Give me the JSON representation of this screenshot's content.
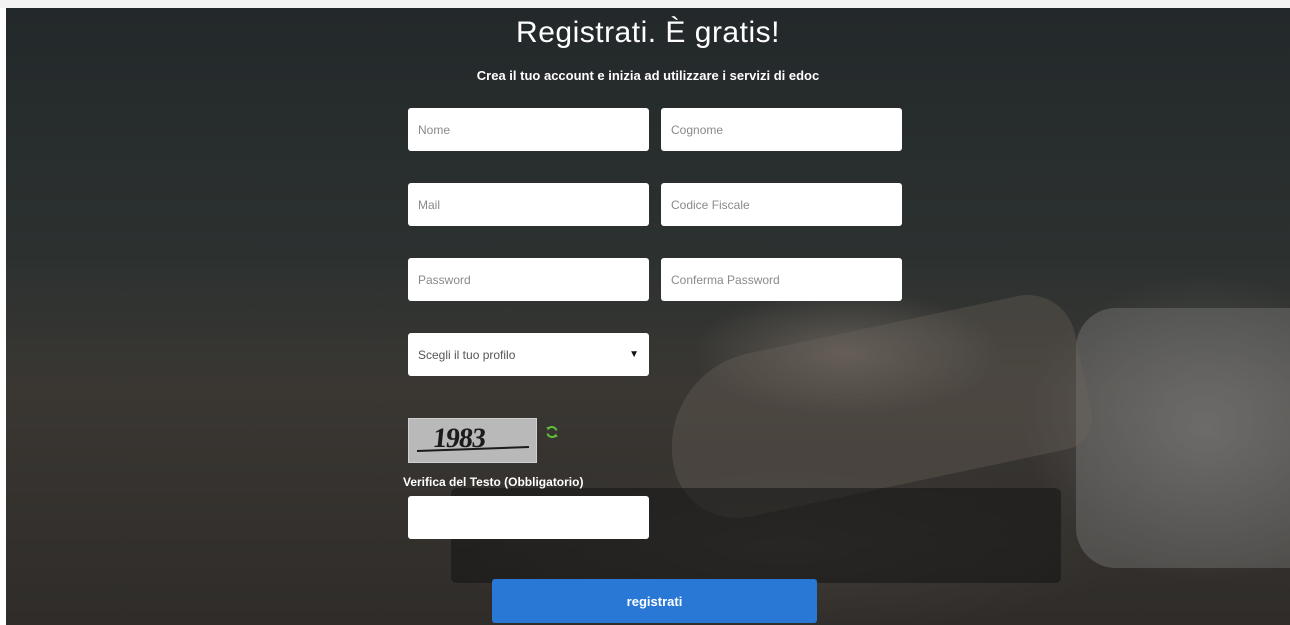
{
  "header": {
    "title": "Registrati. È gratis!",
    "subtitle": "Crea il tuo account e inizia ad utilizzare i servizi di edoc"
  },
  "form": {
    "nome_placeholder": "Nome",
    "cognome_placeholder": "Cognome",
    "mail_placeholder": "Mail",
    "codice_fiscale_placeholder": "Codice Fiscale",
    "password_placeholder": "Password",
    "conferma_password_placeholder": "Conferma Password",
    "profile_select": "Scegli il tuo profilo",
    "captcha_text": "1983",
    "captcha_label": "Verifica del Testo (Obbligatorio)",
    "submit_label": "registrati"
  },
  "icons": {
    "refresh": "refresh-icon",
    "caret": "caret-down-icon"
  },
  "colors": {
    "accent": "#2a78d6",
    "refresh": "#5fbf3a"
  }
}
